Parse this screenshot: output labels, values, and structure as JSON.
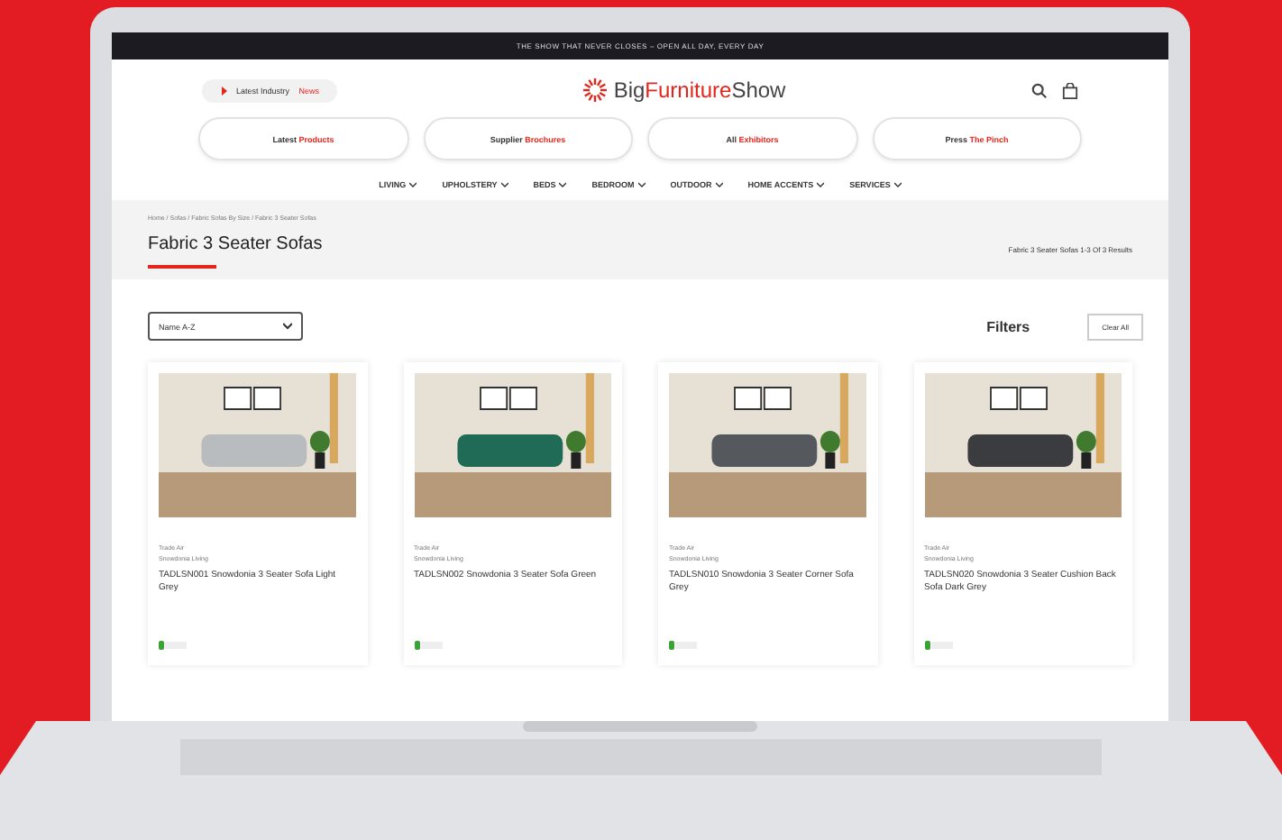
{
  "announcement": "THE SHOW THAT NEVER CLOSES – OPEN ALL DAY, EVERY DAY",
  "news_pill": {
    "label": "Latest Industry ",
    "highlight": "News"
  },
  "logo": {
    "part_1": "Big",
    "part_2": "Furniture",
    "part_3": "Show"
  },
  "quick_links": [
    {
      "label": "Latest ",
      "highlight": "Products"
    },
    {
      "label": "Supplier ",
      "highlight": "Brochures"
    },
    {
      "label": "All ",
      "highlight": "Exhibitors"
    },
    {
      "label": "Press ",
      "highlight": "The Pinch"
    }
  ],
  "menu": [
    "LIVING",
    "UPHOLSTERY",
    "BEDS",
    "BEDROOM",
    "OUTDOOR",
    "HOME ACCENTS",
    "SERVICES"
  ],
  "breadcrumb": "Home / Sofas / Fabric Sofas By Size / Fabric 3 Seater Sofas",
  "page_title": "Fabric 3 Seater Sofas",
  "results": "Fabric 3 Seater Sofas 1-3 Of 3 Results",
  "sort": {
    "value": "Name A-Z"
  },
  "filters": {
    "title": "Filters",
    "clear": "Clear All"
  },
  "products": [
    {
      "supplier": "Trade Air",
      "brand": "Snowdonia Living",
      "name": "TADLSN001 Snowdonia 3 Seater Sofa Light Grey",
      "color": "#b9bcbf"
    },
    {
      "supplier": "Trade Air",
      "brand": "Snowdonia Living",
      "name": "TADLSN002 Snowdonia 3 Seater Sofa Green",
      "color": "#1f6b55"
    },
    {
      "supplier": "Trade Air",
      "brand": "Snowdonia Living",
      "name": "TADLSN010 Snowdonia 3 Seater Corner Sofa Grey",
      "color": "#55595e"
    },
    {
      "supplier": "Trade Air",
      "brand": "Snowdonia Living",
      "name": "TADLSN020 Snowdonia 3 Seater Cushion Back Sofa Dark Grey",
      "color": "#3a3c40"
    }
  ]
}
